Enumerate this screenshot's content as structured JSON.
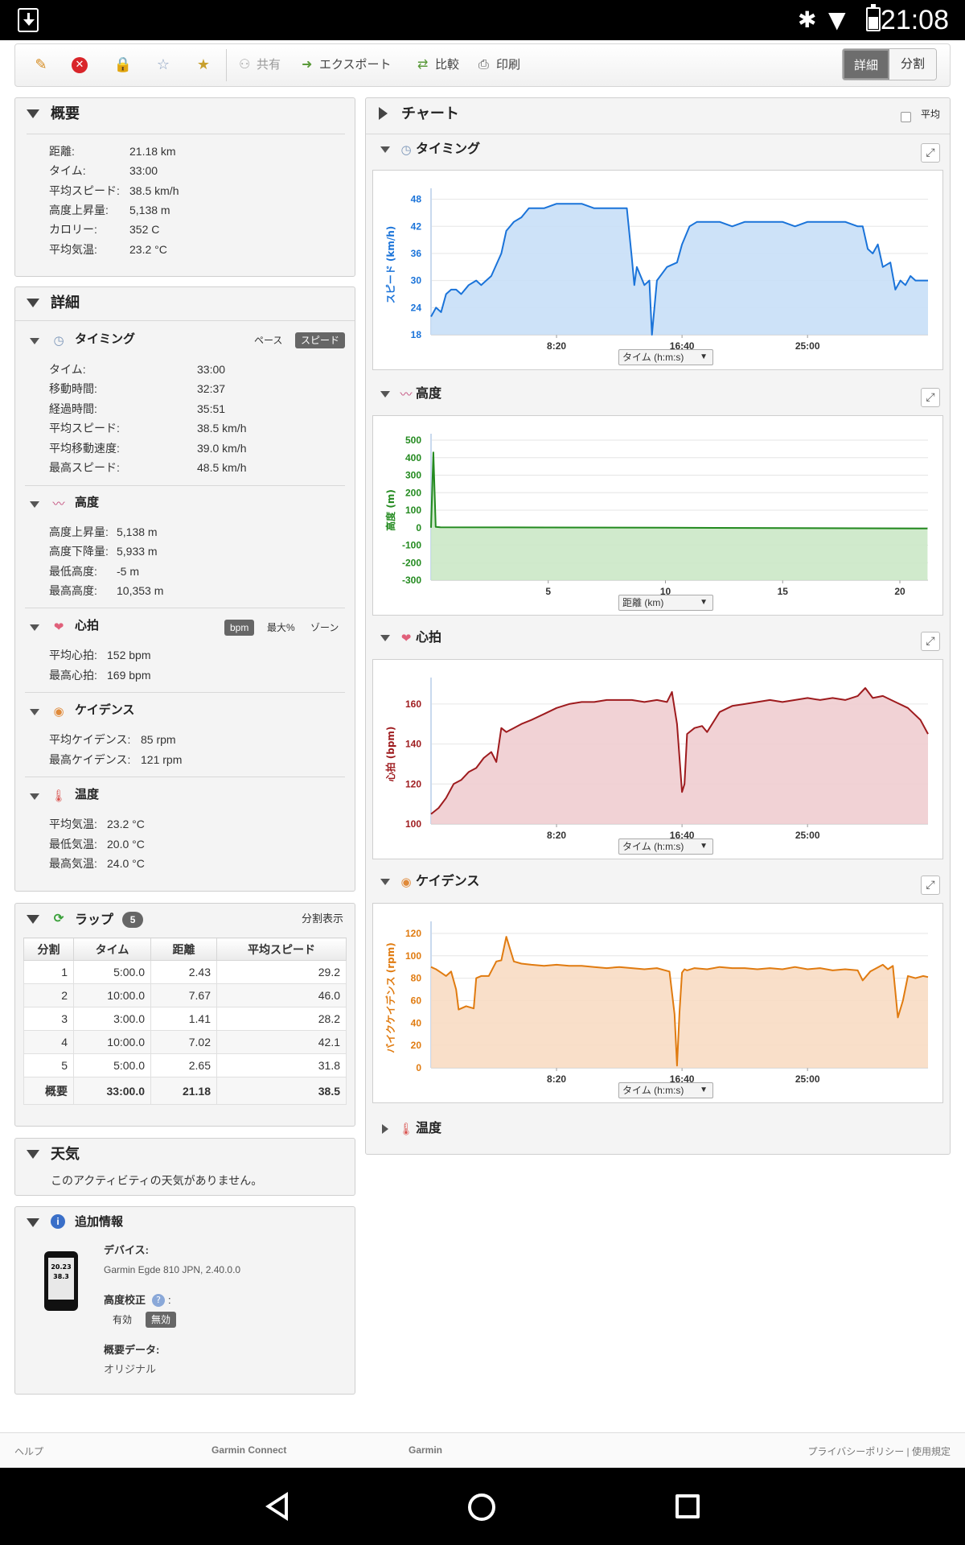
{
  "status": {
    "time": "21:08"
  },
  "toolbar": {
    "share": "共有",
    "export": "エクスポート",
    "compare": "比較",
    "print": "印刷",
    "view_detail": "詳細",
    "view_split": "分割"
  },
  "summary": {
    "title": "概要",
    "rows": [
      {
        "k": "距離:",
        "v": "21.18 km"
      },
      {
        "k": "タイム:",
        "v": "33:00"
      },
      {
        "k": "平均スピード:",
        "v": "38.5 km/h"
      },
      {
        "k": "高度上昇量:",
        "v": "5,138 m"
      },
      {
        "k": "カロリー:",
        "v": "352 C"
      },
      {
        "k": "平均気温:",
        "v": "23.2 °C"
      }
    ]
  },
  "details": {
    "title": "詳細",
    "timing": {
      "title": "タイミング",
      "pace": "ペース",
      "speed": "スピード",
      "rows": [
        {
          "k": "タイム:",
          "v": "33:00"
        },
        {
          "k": "移動時間:",
          "v": "32:37"
        },
        {
          "k": "経過時間:",
          "v": "35:51"
        },
        {
          "k": "平均スピード:",
          "v": "38.5 km/h"
        },
        {
          "k": "平均移動速度:",
          "v": "39.0 km/h"
        },
        {
          "k": "最高スピード:",
          "v": "48.5 km/h"
        }
      ]
    },
    "elevation": {
      "title": "高度",
      "rows": [
        {
          "k": "高度上昇量:",
          "v": "5,138 m"
        },
        {
          "k": "高度下降量:",
          "v": "5,933 m"
        },
        {
          "k": "最低高度:",
          "v": "-5 m"
        },
        {
          "k": "最高高度:",
          "v": "10,353 m"
        }
      ]
    },
    "heart": {
      "title": "心拍",
      "bpm": "bpm",
      "max": "最大%",
      "zone": "ゾーン",
      "rows": [
        {
          "k": "平均心拍:",
          "v": "152 bpm"
        },
        {
          "k": "最高心拍:",
          "v": "169 bpm"
        }
      ]
    },
    "cadence": {
      "title": "ケイデンス",
      "rows": [
        {
          "k": "平均ケイデンス:",
          "v": "85 rpm"
        },
        {
          "k": "最高ケイデンス:",
          "v": "121 rpm"
        }
      ]
    },
    "temperature": {
      "title": "温度",
      "rows": [
        {
          "k": "平均気温:",
          "v": "23.2 °C"
        },
        {
          "k": "最低気温:",
          "v": "20.0 °C"
        },
        {
          "k": "最高気温:",
          "v": "24.0 °C"
        }
      ]
    }
  },
  "laps": {
    "title": "ラップ",
    "count": "5",
    "split_view": "分割表示",
    "headers": [
      "分割",
      "タイム",
      "距離",
      "平均スピード"
    ],
    "rows": [
      [
        "1",
        "5:00.0",
        "2.43",
        "29.2"
      ],
      [
        "2",
        "10:00.0",
        "7.67",
        "46.0"
      ],
      [
        "3",
        "3:00.0",
        "1.41",
        "28.2"
      ],
      [
        "4",
        "10:00.0",
        "7.02",
        "42.1"
      ],
      [
        "5",
        "5:00.0",
        "2.65",
        "31.8"
      ]
    ],
    "total": [
      "概要",
      "33:00.0",
      "21.18",
      "38.5"
    ]
  },
  "weather": {
    "title": "天気",
    "message": "このアクティビティの天気がありません。"
  },
  "extra": {
    "title": "追加情報",
    "device_label": "デバイス:",
    "device": "Garmin Egde 810 JPN, 2.40.0.0",
    "calib_label": "高度校正",
    "calib_on": "有効",
    "calib_off": "無効",
    "summary_label": "概要データ:",
    "summary_value": "オリジナル",
    "screen_line1": "20.23",
    "screen_line2": "38.3"
  },
  "charts": {
    "title": "チャート",
    "average": "平均",
    "timing_title": "タイミング",
    "elevation_title": "高度",
    "heart_title": "心拍",
    "cadence_title": "ケイデンス",
    "temp_title": "温度",
    "axis_time": "タイム (h:m:s)",
    "axis_dist": "距離 (km)"
  },
  "chart_data": [
    {
      "type": "area",
      "color": "#1a73d9",
      "fill": "#c8dff7",
      "ylabel": "スピード (km/h)",
      "yticks": [
        18,
        24,
        30,
        36,
        42,
        48
      ],
      "ylim": [
        18,
        49
      ],
      "xticks": [
        "8:20",
        "16:40",
        "25:00"
      ],
      "xtick_values": [
        500,
        1000,
        1500
      ],
      "xlim": [
        0,
        1980
      ],
      "x": [
        0,
        20,
        40,
        60,
        80,
        100,
        120,
        150,
        180,
        200,
        240,
        280,
        300,
        330,
        360,
        390,
        420,
        450,
        500,
        550,
        600,
        650,
        700,
        730,
        740,
        760,
        780,
        800,
        810,
        820,
        850,
        870,
        880,
        900,
        940,
        980,
        1000,
        1030,
        1060,
        1100,
        1150,
        1200,
        1250,
        1300,
        1350,
        1400,
        1450,
        1500,
        1550,
        1600,
        1650,
        1700,
        1720,
        1740,
        1760,
        1780,
        1800,
        1830,
        1850,
        1870,
        1890,
        1910,
        1930,
        1950,
        1980
      ],
      "y": [
        22,
        24,
        23,
        27,
        28,
        28,
        27,
        29,
        30,
        29,
        31,
        36,
        41,
        43,
        44,
        46,
        46,
        46,
        47,
        47,
        47,
        46,
        46,
        46,
        46,
        46,
        46,
        35,
        29,
        33,
        29,
        30,
        18,
        30,
        33,
        34,
        38,
        42,
        43,
        43,
        43,
        42,
        43,
        43,
        43,
        43,
        42,
        43,
        43,
        43,
        43,
        42,
        42,
        37,
        36,
        38,
        33,
        34,
        28,
        30,
        29,
        31,
        30,
        30,
        30
      ]
    },
    {
      "type": "area",
      "color": "#238a1f",
      "fill": "#cbe8c7",
      "ylabel": "高度 (m)",
      "yticks": [
        -300,
        -200,
        -100,
        0,
        100,
        200,
        300,
        400,
        500
      ],
      "ylim": [
        -300,
        500
      ],
      "xticks": [
        "5",
        "10",
        "15",
        "20"
      ],
      "xtick_values": [
        5,
        10,
        15,
        20
      ],
      "xlim": [
        0,
        21.2
      ],
      "x": [
        0,
        0.1,
        0.2,
        0.4,
        5,
        10,
        15,
        21.18
      ],
      "y": [
        0,
        430,
        5,
        2,
        1,
        0,
        -2,
        -5
      ]
    },
    {
      "type": "area",
      "color": "#9e1b1e",
      "fill": "#efcdd0",
      "ylabel": "心拍 (bpm)",
      "yticks": [
        100,
        120,
        140,
        160
      ],
      "ylim": [
        100,
        170
      ],
      "xticks": [
        "8:20",
        "16:40",
        "25:00"
      ],
      "xtick_values": [
        500,
        1000,
        1500
      ],
      "xlim": [
        0,
        1980
      ],
      "x": [
        0,
        30,
        60,
        90,
        120,
        150,
        180,
        210,
        240,
        260,
        280,
        300,
        330,
        360,
        400,
        450,
        500,
        550,
        600,
        650,
        700,
        750,
        800,
        850,
        900,
        940,
        960,
        980,
        1000,
        1010,
        1020,
        1050,
        1080,
        1100,
        1150,
        1200,
        1250,
        1300,
        1350,
        1400,
        1450,
        1500,
        1550,
        1600,
        1650,
        1700,
        1730,
        1760,
        1800,
        1850,
        1900,
        1950,
        1980
      ],
      "y": [
        105,
        108,
        113,
        120,
        122,
        126,
        128,
        133,
        136,
        131,
        148,
        146,
        148,
        150,
        152,
        155,
        158,
        160,
        161,
        161,
        162,
        162,
        162,
        161,
        162,
        161,
        166,
        150,
        116,
        120,
        145,
        148,
        149,
        146,
        156,
        159,
        160,
        161,
        162,
        161,
        162,
        163,
        162,
        163,
        162,
        164,
        168,
        163,
        164,
        161,
        158,
        152,
        145
      ]
    },
    {
      "type": "area",
      "color": "#e07b10",
      "fill": "#f8dcc3",
      "ylabel": "バイクケイデンス (rpm)",
      "yticks": [
        0,
        20,
        40,
        60,
        80,
        100,
        120
      ],
      "ylim": [
        0,
        125
      ],
      "xticks": [
        "8:20",
        "16:40",
        "25:00"
      ],
      "xtick_values": [
        500,
        1000,
        1500
      ],
      "xlim": [
        0,
        1980
      ],
      "x": [
        0,
        20,
        40,
        60,
        80,
        100,
        110,
        140,
        170,
        180,
        200,
        230,
        260,
        280,
        300,
        330,
        360,
        400,
        450,
        500,
        550,
        600,
        650,
        700,
        750,
        800,
        850,
        900,
        950,
        970,
        980,
        990,
        1000,
        1010,
        1020,
        1050,
        1100,
        1150,
        1200,
        1250,
        1300,
        1350,
        1400,
        1450,
        1500,
        1550,
        1600,
        1650,
        1700,
        1720,
        1750,
        1800,
        1820,
        1840,
        1860,
        1880,
        1900,
        1930,
        1960,
        1980
      ],
      "y": [
        90,
        88,
        85,
        82,
        86,
        70,
        52,
        55,
        53,
        80,
        82,
        82,
        95,
        96,
        117,
        95,
        93,
        92,
        91,
        92,
        91,
        91,
        90,
        89,
        90,
        89,
        88,
        89,
        86,
        48,
        2,
        50,
        85,
        88,
        87,
        89,
        88,
        90,
        89,
        89,
        88,
        89,
        88,
        90,
        88,
        89,
        87,
        88,
        87,
        78,
        86,
        92,
        88,
        91,
        45,
        60,
        82,
        80,
        82,
        81
      ]
    }
  ],
  "footer": {
    "help": "ヘルプ",
    "gc": "Garmin Connect",
    "garmin": "Garmin",
    "legal": "プライバシーポリシー | 使用規定"
  }
}
